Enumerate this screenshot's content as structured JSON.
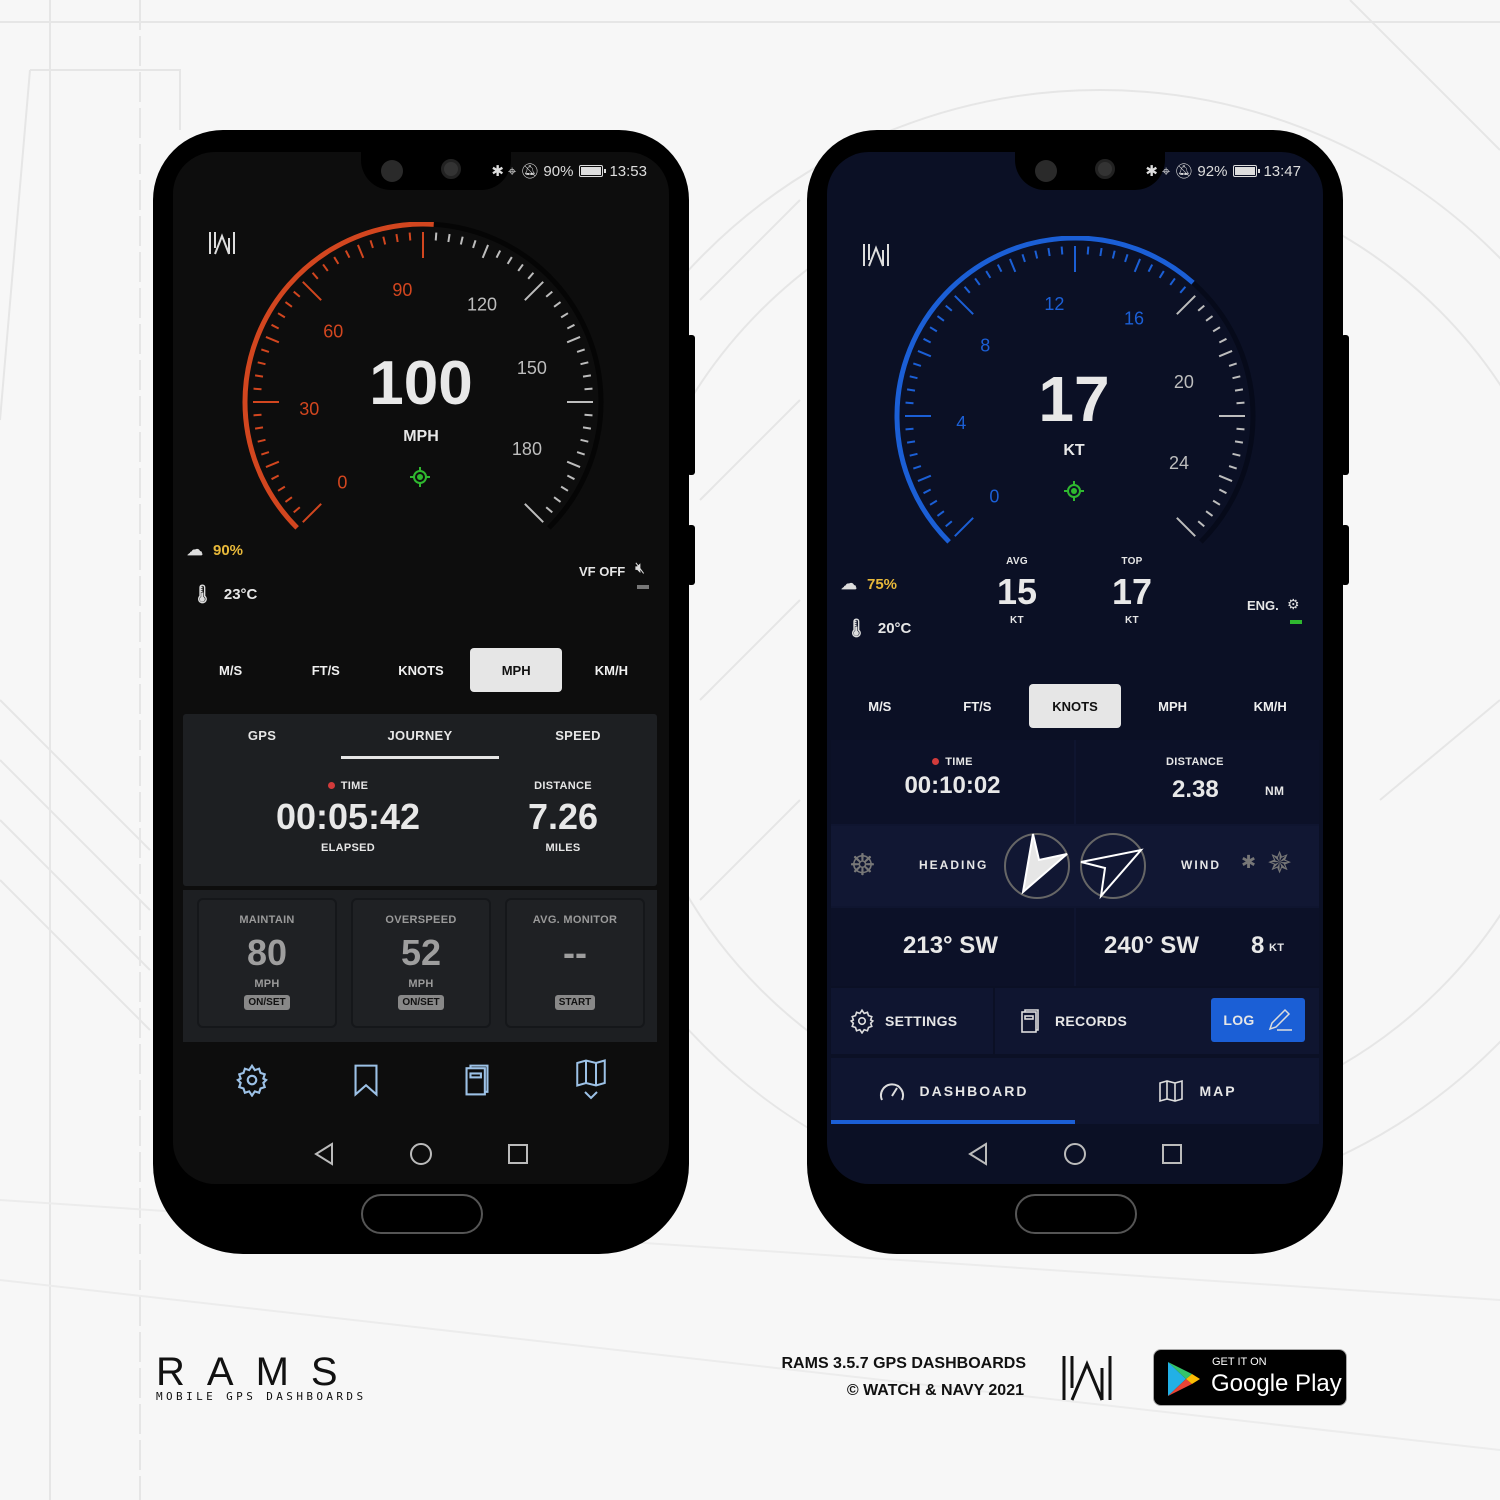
{
  "brand": {
    "logo_text": "RAMS",
    "tagline": "MOBILE GPS DASHBOARDS",
    "footer_line1": "RAMS 3.5.7 GPS DASHBOARDS",
    "footer_line2": "© WATCH & NAVY 2021",
    "store_small": "GET IT ON",
    "store_big": "Google Play"
  },
  "phones": [
    {
      "theme": "dark",
      "accent": "#d2461f",
      "status": {
        "battery": "90%",
        "time": "13:53"
      },
      "gauge": {
        "value": "100",
        "unit": "MPH",
        "min": 0,
        "max": 195,
        "ticks": [
          "0",
          "30",
          "60",
          "90",
          "120",
          "150",
          "180"
        ],
        "fill_value": 100
      },
      "weather": {
        "cloud": "90%",
        "temp": "23°C"
      },
      "vf": {
        "label": "VF OFF"
      },
      "unit_tabs": [
        "M/S",
        "FT/S",
        "KNOTS",
        "MPH",
        "KM/H"
      ],
      "unit_active": 3,
      "panel_tabs": [
        "GPS",
        "JOURNEY",
        "SPEED"
      ],
      "panel_active": 1,
      "journey": {
        "time_label": "TIME",
        "time_value": "00:05:42",
        "time_sub": "ELAPSED",
        "dist_label": "DISTANCE",
        "dist_value": "7.26",
        "dist_sub": "MILES"
      },
      "cards": [
        {
          "title": "MAINTAIN",
          "value": "80",
          "unit": "MPH",
          "button": "ON/SET"
        },
        {
          "title": "OVERSPEED",
          "value": "52",
          "unit": "MPH",
          "button": "ON/SET"
        },
        {
          "title": "AVG. MONITOR",
          "value": "--",
          "unit": "",
          "button": "START"
        }
      ],
      "bottom_icons": [
        "settings-icon",
        "bookmark-icon",
        "records-icon",
        "map-icon"
      ]
    },
    {
      "theme": "navy",
      "accent": "#1b5fd6",
      "status": {
        "battery": "92%",
        "time": "13:47"
      },
      "gauge": {
        "value": "17",
        "unit": "KT",
        "min": 0,
        "max": 26,
        "ticks": [
          "0",
          "4",
          "8",
          "12",
          "16",
          "20",
          "24"
        ],
        "fill_value": 17
      },
      "weather": {
        "cloud": "75%",
        "temp": "20°C"
      },
      "stats": {
        "avg_label": "AVG",
        "avg_value": "15",
        "avg_unit": "KT",
        "top_label": "TOP",
        "top_value": "17",
        "top_unit": "KT"
      },
      "engine": {
        "label": "ENG."
      },
      "unit_tabs": [
        "M/S",
        "FT/S",
        "KNOTS",
        "MPH",
        "KM/H"
      ],
      "unit_active": 2,
      "journey": {
        "time_label": "TIME",
        "time_value": "00:10:02",
        "dist_label": "DISTANCE",
        "dist_value": "2.38",
        "dist_unit": "NM"
      },
      "heading": {
        "label": "HEADING",
        "value": "213° SW"
      },
      "wind": {
        "label": "WIND",
        "value": "240° SW",
        "speed": "8",
        "speed_unit": "KT"
      },
      "actions": {
        "settings": "SETTINGS",
        "records": "RECORDS",
        "log": "LOG"
      },
      "bottom_tabs": [
        "DASHBOARD",
        "MAP"
      ],
      "bottom_active": 0
    }
  ]
}
